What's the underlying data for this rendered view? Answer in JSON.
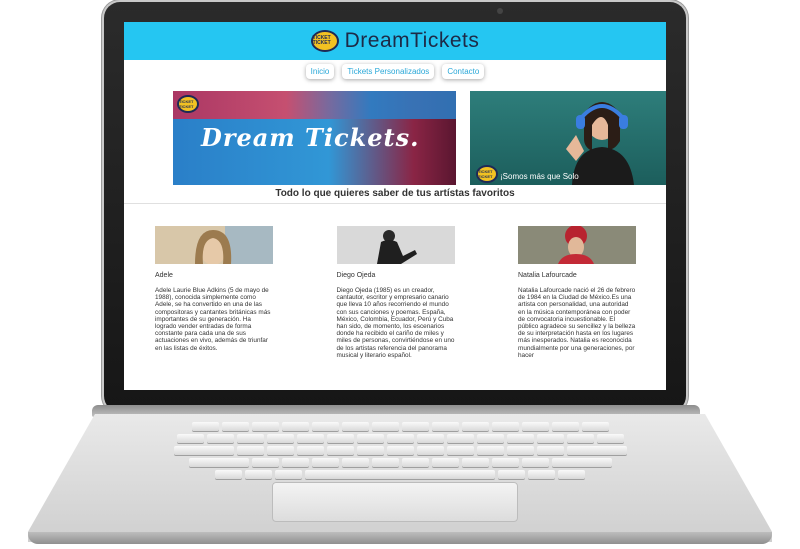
{
  "site": {
    "brand": "DreamTickets",
    "badge_text": "TICKET TICKET"
  },
  "nav": {
    "items": [
      "Inicio",
      "Tickets Personalizados",
      "Contacto"
    ]
  },
  "banners": {
    "left_text": "Dream Tickets.",
    "right_caption": "¡Somos más que Solo"
  },
  "section": {
    "title": "Todo lo que quieres saber de tus artístas favoritos"
  },
  "artists": [
    {
      "name": "Adele",
      "bio": "Adele Laurie Blue Adkins (5 de mayo de 1988), conocida simplemente como Adele, se ha convertido en una de las compositoras y cantantes británicas más importantes de su generación. Ha logrado vender entradas de forma constante para cada una de sus actuaciones en vivo, además de triunfar en las listas de éxitos."
    },
    {
      "name": "Diego Ojeda",
      "bio": "Diego Ojeda (1985) es un creador, cantautor, escritor y empresario canario que lleva 10 años recorriendo el mundo con sus canciones y poemas. España, México, Colombia, Ecuador, Perú y Cuba han sido, de momento, los escenarios donde ha recibido el cariño de miles y miles de personas, convirtiéndose en uno de los artistas referencia del panorama musical y literario español."
    },
    {
      "name": "Natalia Lafourcade",
      "bio": "Natalia Lafourcade nació el 26 de febrero de 1984 en la Ciudad de México.Es una artista con personalidad, una autoridad en la música contemporánea con poder de convocatoria incuestionable. El público agradece su sencillez y la belleza de su interpretación hasta en los lugares más inesperados. Natalia es reconocida mundialmente por una generaciones, por hacer"
    }
  ],
  "colors": {
    "header_bg": "#25c6f2",
    "nav_text": "#2aa8d8",
    "brand_text": "#1d2a47"
  }
}
